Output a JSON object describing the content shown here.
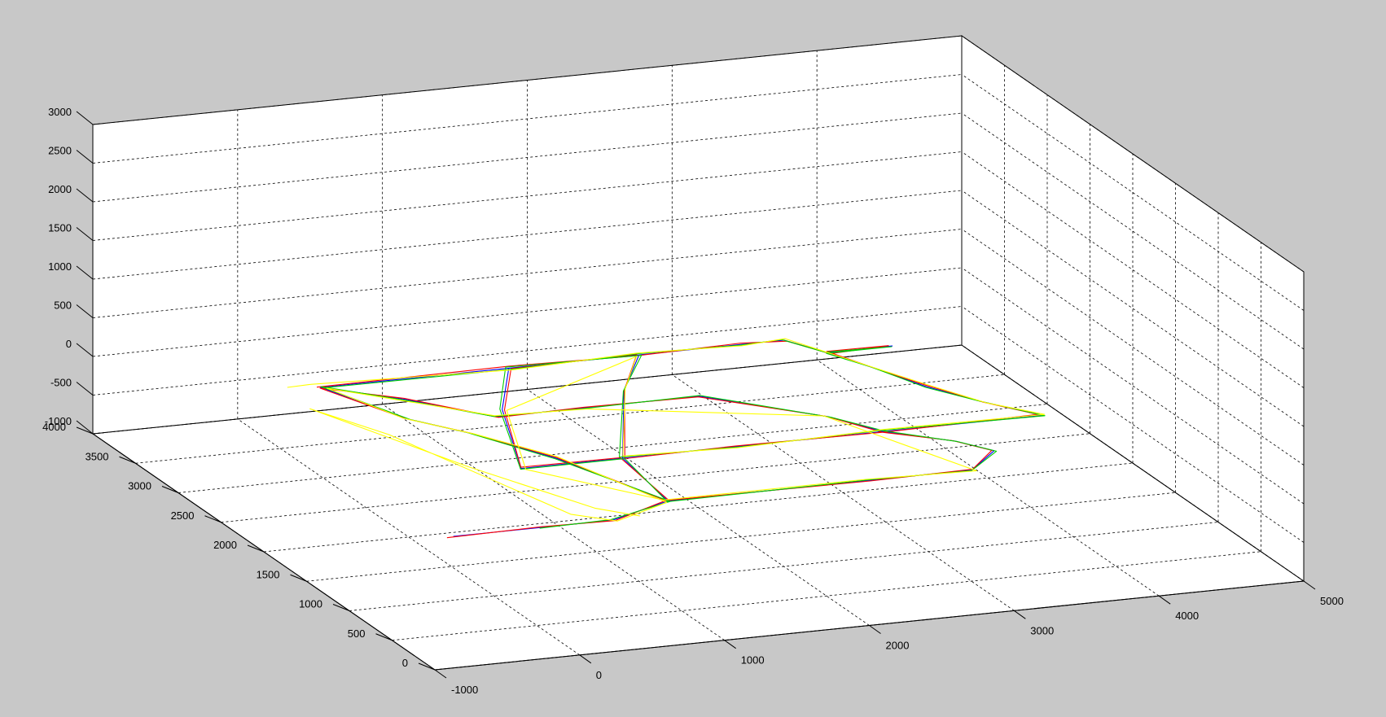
{
  "figure": {
    "background": "#c8c8c8",
    "axes_face": "#ffffff"
  },
  "chart_data": {
    "type": "line3d",
    "title": "",
    "xlabel": "",
    "ylabel": "",
    "zlabel": "",
    "grid": true,
    "x_ticks": [
      -1000,
      0,
      1000,
      2000,
      3000,
      4000,
      5000
    ],
    "y_ticks": [
      0,
      500,
      1000,
      1500,
      2000,
      2500,
      3000,
      3500,
      4000
    ],
    "z_ticks": [
      -1000,
      -500,
      0,
      500,
      1000,
      1500,
      2000,
      2500,
      3000
    ],
    "xlim": [
      -1000,
      5000
    ],
    "ylim": [
      0,
      4000
    ],
    "zlim": [
      -1000,
      3000
    ],
    "series": [
      {
        "color": "#0000ff",
        "points": [
          [
            100,
            3200,
            0
          ],
          [
            1400,
            3200,
            0
          ],
          [
            2300,
            3200,
            0
          ],
          [
            3000,
            3200,
            0
          ],
          [
            3300,
            3200,
            0
          ],
          [
            3450,
            2950,
            0
          ],
          [
            3900,
            2950,
            0
          ],
          [
            3450,
            2950,
            0
          ],
          [
            3600,
            2650,
            0
          ],
          [
            3750,
            2300,
            0
          ],
          [
            3950,
            2000,
            0
          ],
          [
            4200,
            1700,
            0
          ],
          [
            3100,
            1700,
            0
          ],
          [
            2100,
            1700,
            0
          ],
          [
            1300,
            1700,
            0
          ],
          [
            1900,
            2700,
            0
          ],
          [
            2300,
            3200,
            0
          ],
          [
            1400,
            3200,
            0
          ],
          [
            1000,
            2600,
            0
          ],
          [
            600,
            1700,
            0
          ],
          [
            1300,
            1700,
            0
          ],
          [
            1200,
            1000,
            0
          ],
          [
            2600,
            1000,
            0
          ],
          [
            3300,
            1000,
            0
          ],
          [
            3600,
            1250,
            0
          ],
          [
            3450,
            1450,
            0
          ],
          [
            3100,
            1700,
            0
          ],
          [
            2900,
            2000,
            0
          ],
          [
            2300,
            2500,
            0
          ],
          [
            1500,
            2500,
            0
          ],
          [
            900,
            2500,
            0
          ],
          [
            500,
            2900,
            0
          ],
          [
            100,
            3200,
            0
          ],
          [
            350,
            2600,
            0
          ],
          [
            600,
            2300,
            0
          ],
          [
            900,
            1800,
            0
          ],
          [
            1200,
            1000,
            0
          ],
          [
            700,
            800,
            0
          ],
          [
            200,
            800,
            0
          ],
          [
            -400,
            800,
            0
          ]
        ]
      },
      {
        "color": "#ff0000",
        "points": [
          [
            80,
            3210,
            0
          ],
          [
            1420,
            3230,
            0
          ],
          [
            2280,
            3190,
            0
          ],
          [
            3010,
            3220,
            0
          ],
          [
            3310,
            3180,
            0
          ],
          [
            3460,
            2930,
            0
          ],
          [
            3880,
            2960,
            0
          ],
          [
            3460,
            2970,
            0
          ],
          [
            3610,
            2630,
            0
          ],
          [
            3760,
            2320,
            0
          ],
          [
            3960,
            1980,
            0
          ],
          [
            4180,
            1720,
            0
          ],
          [
            3110,
            1690,
            0
          ],
          [
            2090,
            1710,
            0
          ],
          [
            1310,
            1690,
            0
          ],
          [
            1910,
            2710,
            0
          ],
          [
            2290,
            3210,
            0
          ],
          [
            1410,
            3190,
            0
          ],
          [
            1010,
            2590,
            0
          ],
          [
            610,
            1720,
            0
          ],
          [
            1290,
            1710,
            0
          ],
          [
            1210,
            1010,
            0
          ],
          [
            2590,
            990,
            0
          ],
          [
            3310,
            1010,
            0
          ],
          [
            3590,
            1260,
            0
          ],
          [
            3440,
            1460,
            0
          ],
          [
            3090,
            1690,
            0
          ],
          [
            2890,
            2010,
            0
          ],
          [
            2290,
            2490,
            0
          ],
          [
            1510,
            2510,
            0
          ],
          [
            910,
            2490,
            0
          ],
          [
            510,
            2910,
            0
          ],
          [
            90,
            3190,
            0
          ],
          [
            340,
            2610,
            0
          ],
          [
            610,
            2290,
            0
          ],
          [
            910,
            1810,
            0
          ],
          [
            1190,
            1010,
            0
          ],
          [
            710,
            790,
            0
          ],
          [
            210,
            810,
            0
          ],
          [
            -450,
            790,
            0
          ]
        ]
      },
      {
        "color": "#00cc00",
        "points": [
          [
            120,
            3190,
            0
          ],
          [
            1390,
            3180,
            0
          ],
          [
            2310,
            3220,
            0
          ],
          [
            2990,
            3190,
            0
          ],
          [
            3290,
            3210,
            0
          ],
          [
            3440,
            2960,
            0
          ],
          [
            3890,
            2940,
            0
          ],
          [
            3440,
            2940,
            0
          ],
          [
            3590,
            2670,
            0
          ],
          [
            3740,
            2290,
            0
          ],
          [
            3940,
            2010,
            0
          ],
          [
            4210,
            1690,
            0
          ],
          [
            3090,
            1720,
            0
          ],
          [
            2110,
            1690,
            0
          ],
          [
            1290,
            1720,
            0
          ],
          [
            1890,
            2690,
            0
          ],
          [
            2310,
            3190,
            0
          ],
          [
            1390,
            3220,
            0
          ],
          [
            990,
            2610,
            0
          ],
          [
            590,
            1690,
            0
          ],
          [
            1310,
            1690,
            0
          ],
          [
            1190,
            990,
            0
          ],
          [
            2610,
            1010,
            0
          ],
          [
            3290,
            990,
            0
          ],
          [
            3610,
            1240,
            0
          ],
          [
            3460,
            1440,
            0
          ],
          [
            3110,
            1710,
            0
          ],
          [
            2910,
            1990,
            0
          ],
          [
            2310,
            2510,
            0
          ],
          [
            1490,
            2490,
            0
          ],
          [
            890,
            2510,
            0
          ],
          [
            490,
            2890,
            0
          ],
          [
            110,
            3210,
            0
          ],
          [
            360,
            2590,
            0
          ],
          [
            590,
            2310,
            0
          ],
          [
            890,
            1790,
            0
          ],
          [
            1210,
            990,
            0
          ],
          [
            690,
            810,
            0
          ],
          [
            190,
            790,
            0
          ]
        ]
      },
      {
        "color": "#ffff00",
        "points": [
          [
            -100,
            3250,
            0
          ],
          [
            60,
            3260,
            0
          ],
          [
            1400,
            3170,
            0
          ],
          [
            2300,
            3230,
            0
          ],
          [
            3000,
            3180,
            0
          ],
          [
            3320,
            3220,
            0
          ],
          [
            3470,
            2920,
            0
          ],
          [
            3620,
            2620,
            0
          ],
          [
            3770,
            2330,
            0
          ],
          [
            3970,
            1970,
            0
          ],
          [
            4220,
            1710,
            0
          ],
          [
            3120,
            1730,
            0
          ],
          [
            2080,
            1680,
            0
          ],
          [
            1320,
            1730,
            0
          ],
          [
            1920,
            2720,
            0
          ],
          [
            2270,
            3180,
            0
          ],
          [
            1020,
            2580,
            0
          ],
          [
            620,
            1680,
            0
          ],
          [
            1180,
            1020,
            0
          ],
          [
            2580,
            1020,
            0
          ],
          [
            3320,
            980,
            0
          ],
          [
            2880,
            2020,
            0
          ],
          [
            1520,
            2480,
            0
          ],
          [
            900,
            2520,
            0
          ],
          [
            130,
            3180,
            0
          ],
          [
            330,
            2620,
            0
          ],
          [
            620,
            2280,
            0
          ],
          [
            920,
            1820,
            0
          ],
          [
            1180,
            980,
            0
          ],
          [
            720,
            780,
            0
          ],
          [
            500,
            950,
            0
          ],
          [
            100,
            2400,
            0
          ],
          [
            -150,
            2900,
            0
          ],
          [
            300,
            1800,
            0
          ],
          [
            700,
            1000,
            0
          ],
          [
            900,
            820,
            0
          ]
        ]
      }
    ]
  }
}
